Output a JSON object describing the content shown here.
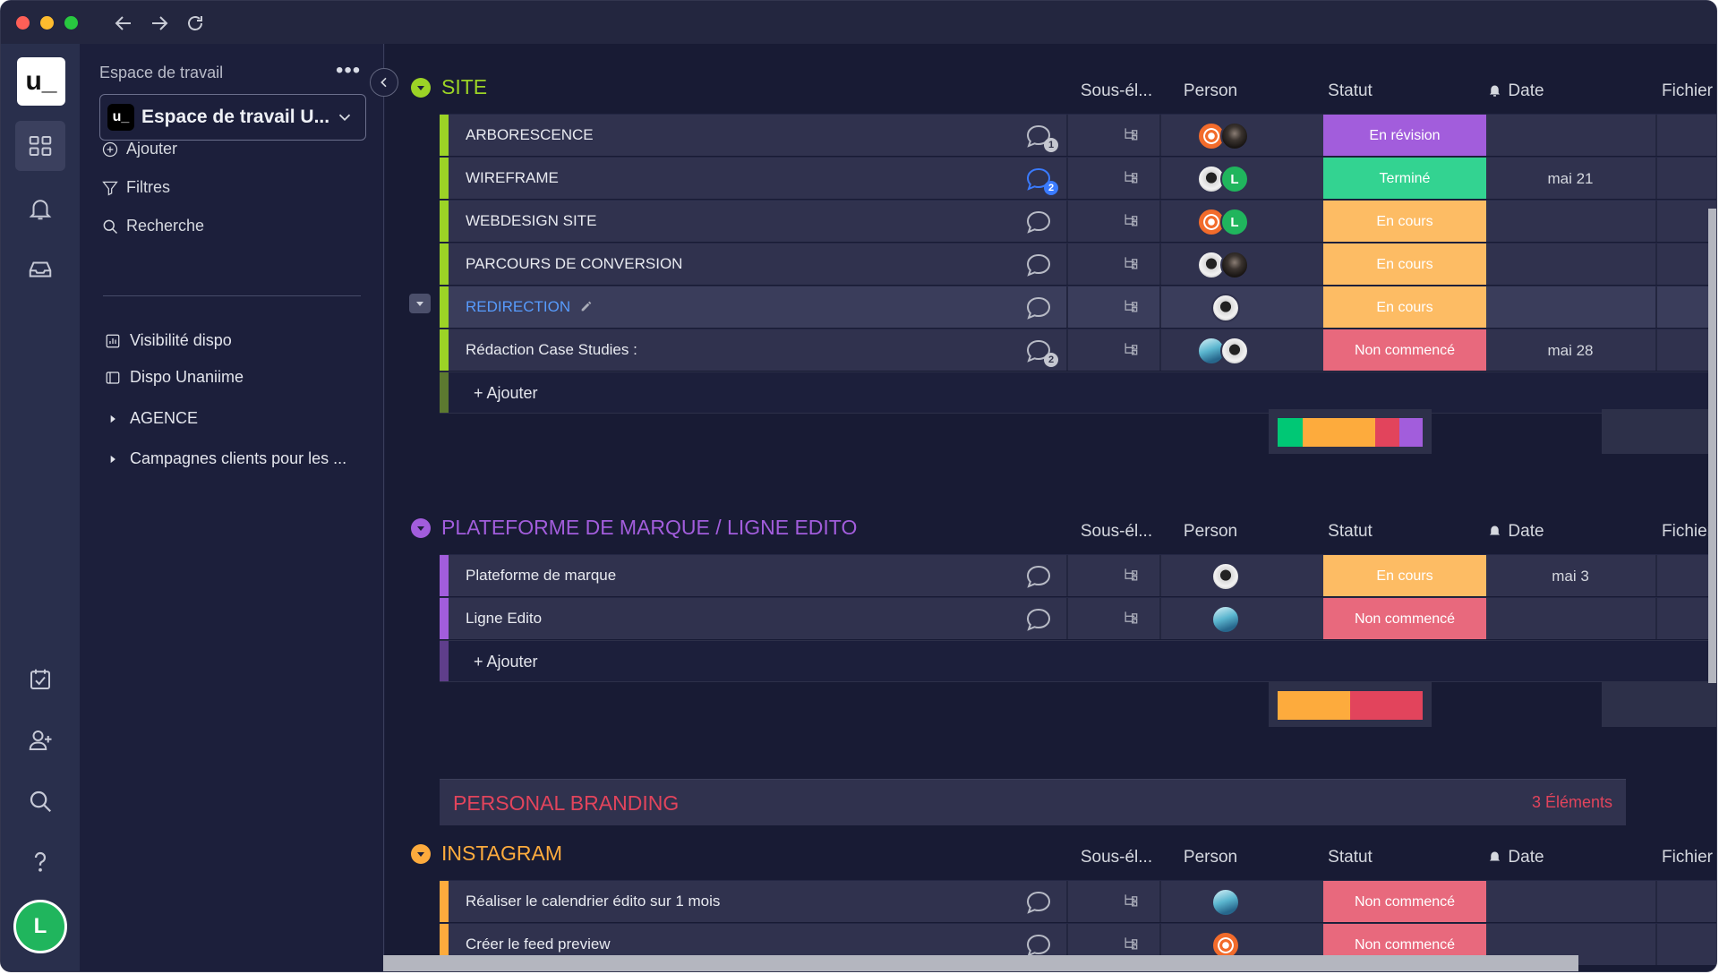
{
  "app": {
    "logo_text": "u_"
  },
  "sidebar": {
    "workspace_label": "Espace de travail",
    "more_dots": "•••",
    "workspace_name": "Espace de travail U...",
    "workspace_logo": "u_",
    "actions": [
      {
        "label": "Ajouter",
        "icon": "plus-circle-icon"
      },
      {
        "label": "Filtres",
        "icon": "filter-icon"
      },
      {
        "label": "Recherche",
        "icon": "search-icon"
      }
    ],
    "boards": [
      {
        "label": "Visibilité dispo",
        "icon": "chart-icon"
      },
      {
        "label": "Dispo Unaniime",
        "icon": "board-icon"
      }
    ],
    "folders": [
      {
        "label": "AGENCE"
      },
      {
        "label": "Campagnes clients pour les ..."
      }
    ],
    "user_initial": "L"
  },
  "columns": {
    "subitems": "Sous-él...",
    "person": "Person",
    "status": "Statut",
    "date": "Date",
    "files": "Fichier"
  },
  "colors": {
    "green": "#9cd326",
    "purple": "#a25ddc",
    "red": "#e2445c",
    "orange": "#fdab3d",
    "status_review": "#a25ddc",
    "status_done": "#33d391",
    "status_working": "#fdbc64",
    "status_not_started": "#e8697d"
  },
  "groups": [
    {
      "title": "SITE",
      "color": "#9cd326",
      "rows": [
        {
          "name": "ARBORESCENCE",
          "comments": "1",
          "status": "En révision",
          "date": ""
        },
        {
          "name": "WIREFRAME",
          "comments": "2",
          "status": "Terminé",
          "date": "mai 21"
        },
        {
          "name": "WEBDESIGN SITE",
          "comments": "",
          "status": "En cours",
          "date": ""
        },
        {
          "name": "PARCOURS DE CONVERSION",
          "comments": "",
          "status": "En cours",
          "date": ""
        },
        {
          "name": "REDIRECTION",
          "comments": "",
          "status": "En cours",
          "date": ""
        },
        {
          "name": "Rédaction Case Studies :",
          "comments": "2",
          "status": "Non commencé",
          "date": "mai 28"
        }
      ],
      "add_label": "+ Ajouter"
    },
    {
      "title": "PLATEFORME DE MARQUE / LIGNE EDITO",
      "color": "#a25ddc",
      "rows": [
        {
          "name": "Plateforme de marque",
          "status": "En cours",
          "date": "mai 3"
        },
        {
          "name": "Ligne Edito",
          "status": "Non commencé",
          "date": ""
        }
      ],
      "add_label": "+ Ajouter"
    },
    {
      "title": "PERSONAL BRANDING",
      "collapsed": true,
      "count_label": "3 Éléments"
    },
    {
      "title": "INSTAGRAM",
      "color": "#fdab3d",
      "rows": [
        {
          "name": "Réaliser le calendrier édito sur 1 mois",
          "status": "Non commencé",
          "date": ""
        },
        {
          "name": "Créer le feed preview",
          "status": "Non commencé",
          "date": ""
        }
      ]
    }
  ],
  "avatars": {
    "green_initial": "L"
  }
}
